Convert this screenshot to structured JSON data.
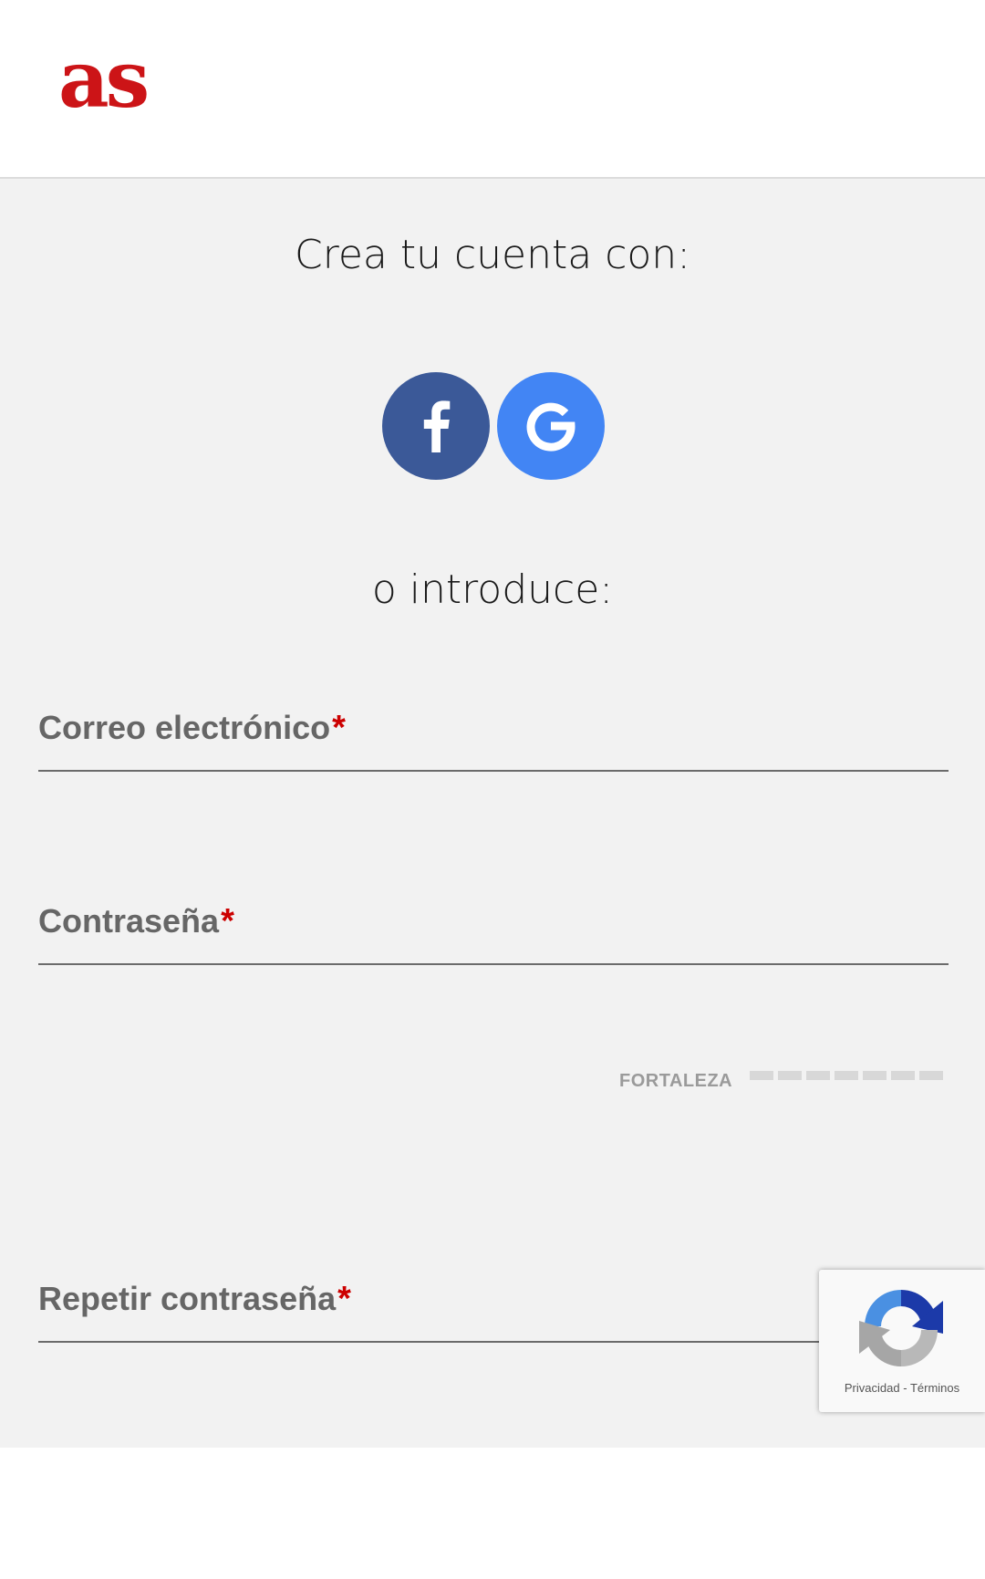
{
  "header": {
    "logo_text": "as"
  },
  "signup": {
    "title": "Crea tu cuenta con:",
    "social": [
      {
        "name": "facebook",
        "icon": "facebook-icon",
        "color": "#3b5998"
      },
      {
        "name": "google",
        "icon": "google-icon",
        "color": "#4285f4"
      }
    ],
    "or_text": "o introduce:"
  },
  "form": {
    "email_label": "Correo electrónico",
    "password_label": "Contraseña",
    "repeat_password_label": "Repetir contraseña",
    "required_mark": "*",
    "strength_label": "FORTALEZA",
    "strength_level": 0,
    "strength_segments": 7
  },
  "recaptcha": {
    "privacy": "Privacidad",
    "separator": "-",
    "terms": "Términos"
  },
  "colors": {
    "brand": "#cc1417",
    "required": "#cc0000",
    "background": "#f2f2f2"
  }
}
